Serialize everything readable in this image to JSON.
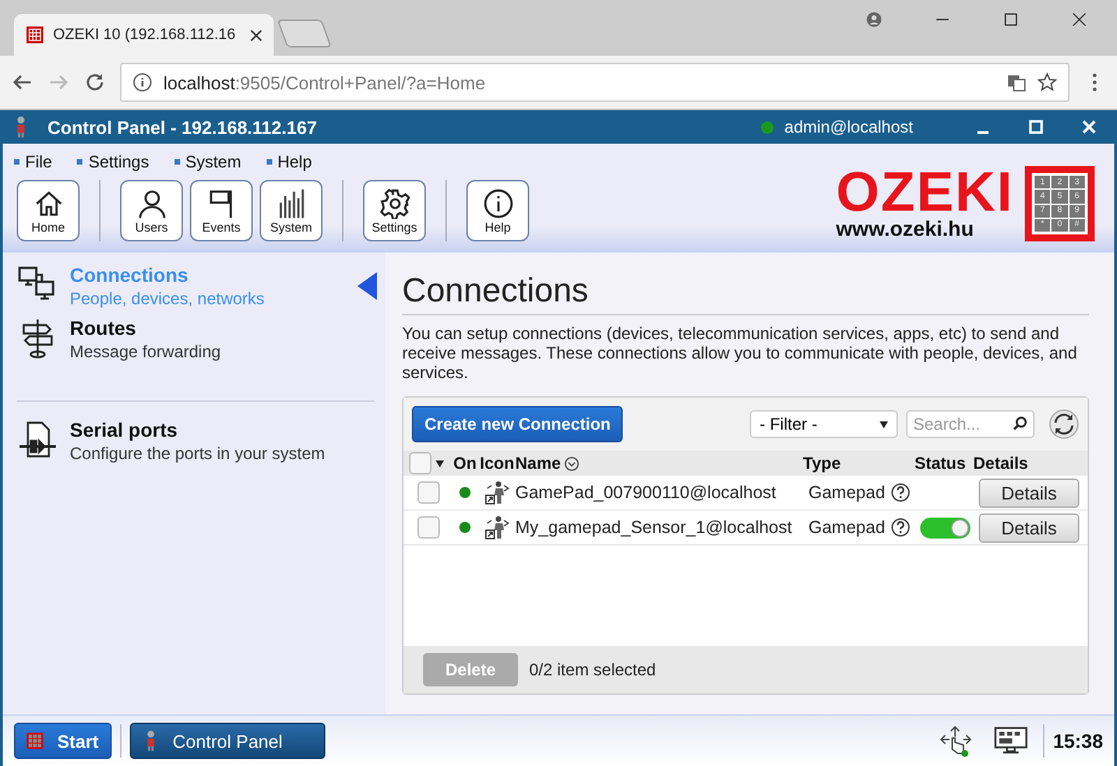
{
  "browser": {
    "tab_title": "OZEKI 10 (192.168.112.16",
    "url_host": "localhost",
    "url_rest": ":9505/Control+Panel/?a=Home"
  },
  "app": {
    "title": "Control Panel - 192.168.112.167",
    "user": "admin@localhost",
    "user_online": true
  },
  "menu": [
    "File",
    "Settings",
    "System",
    "Help"
  ],
  "toolbar": [
    {
      "label": "Home",
      "kind": "home"
    },
    {
      "label": "Users",
      "kind": "user"
    },
    {
      "label": "Events",
      "kind": "flag"
    },
    {
      "label": "System",
      "kind": "bars"
    },
    {
      "label": "Settings",
      "kind": "gear"
    },
    {
      "label": "Help",
      "kind": "info"
    }
  ],
  "logo": {
    "name": "OZEKI",
    "url": "www.ozeki.hu",
    "keys": [
      "1",
      "2",
      "3",
      "4",
      "5",
      "6",
      "7",
      "8",
      "9",
      "*",
      "0",
      "#"
    ]
  },
  "sidebar": {
    "items": [
      {
        "title": "Connections",
        "subtitle": "People, devices, networks",
        "kind": "network",
        "selected": true
      },
      {
        "title": "Routes",
        "subtitle": "Message forwarding",
        "kind": "signpost",
        "selected": false
      },
      {
        "title": "Serial ports",
        "subtitle": "Configure the ports in your system",
        "kind": "port",
        "selected": false
      }
    ]
  },
  "main": {
    "heading": "Connections",
    "description": "You can setup connections (devices, telecommunication services, apps, etc) to send and receive messages. These connections allow you to communicate with people, devices, and services.",
    "create_button": "Create new Connection",
    "filter": "- Filter -",
    "search": {
      "placeholder": "Search..."
    },
    "table": {
      "all_checked": false,
      "columns": [
        "On",
        "Icon",
        "Name",
        "Type",
        "Status",
        "Details"
      ],
      "rows": [
        {
          "checked": false,
          "on": true,
          "name": "GamePad_007900110@localhost",
          "type": "Gamepad",
          "has_toggle": false,
          "details": "Details"
        },
        {
          "checked": false,
          "on": true,
          "name": "My_gamepad_Sensor_1@localhost",
          "type": "Gamepad",
          "has_toggle": true,
          "toggle_on": true,
          "details": "Details"
        }
      ]
    },
    "delete_button": "Delete",
    "selection": "0/2 item selected"
  },
  "taskbar": {
    "start": "Start",
    "apps": [
      "Control Panel"
    ],
    "time": "15:38"
  }
}
